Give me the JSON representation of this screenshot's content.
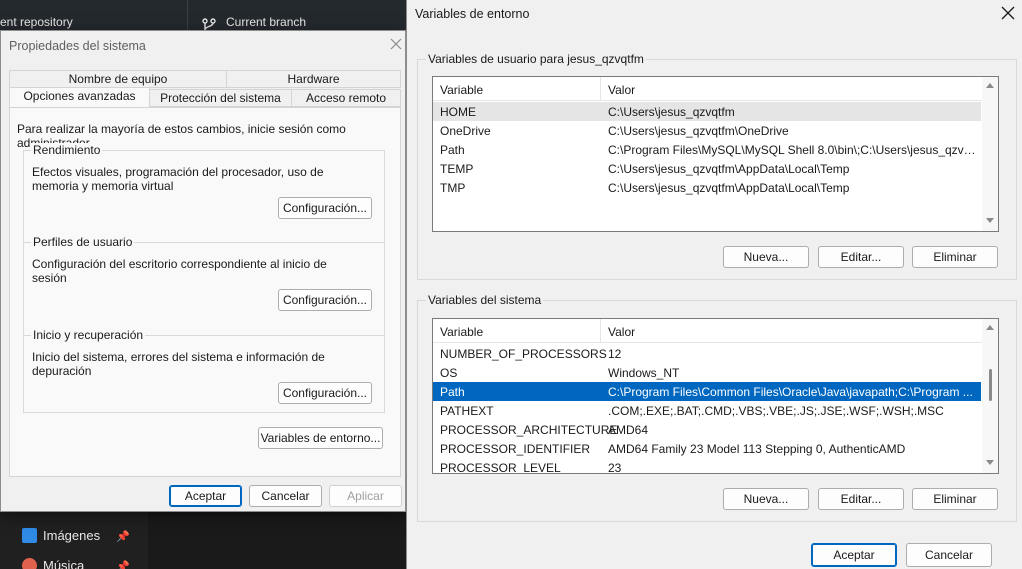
{
  "background_app": {
    "repo_label": "ent repository",
    "branch_label": "Current branch",
    "nav_items": [
      {
        "label": "Imágenes",
        "icon": "images-icon"
      },
      {
        "label": "Música",
        "icon": "music-icon"
      }
    ]
  },
  "system_properties": {
    "title": "Propiedades del sistema",
    "tabs": [
      "Nombre de equipo",
      "Hardware",
      "Opciones avanzadas",
      "Protección del sistema",
      "Acceso remoto"
    ],
    "active_tab": "Opciones avanzadas",
    "intro": "Para realizar la mayoría de estos cambios, inicie sesión como administrador.",
    "groups": [
      {
        "title": "Rendimiento",
        "description": "Efectos visuales, programación del procesador, uso de memoria y memoria virtual",
        "button": "Configuración..."
      },
      {
        "title": "Perfiles de usuario",
        "description": "Configuración del escritorio correspondiente al inicio de sesión",
        "button": "Configuración..."
      },
      {
        "title": "Inicio y recuperación",
        "description": "Inicio del sistema, errores del sistema e información de depuración",
        "button": "Configuración..."
      }
    ],
    "env_button": "Variables de entorno...",
    "ok_button": "Aceptar",
    "cancel_button": "Cancelar",
    "apply_button": "Aplicar"
  },
  "env_vars": {
    "title": "Variables de entorno",
    "user_group_title": "Variables de usuario para jesus_qzvqtfm",
    "system_group_title": "Variables del sistema",
    "col_variable": "Variable",
    "col_value": "Valor",
    "user_vars": [
      {
        "name": "HOME",
        "value": "C:\\Users\\jesus_qzvqtfm"
      },
      {
        "name": "OneDrive",
        "value": "C:\\Users\\jesus_qzvqtfm\\OneDrive"
      },
      {
        "name": "Path",
        "value": "C:\\Program Files\\MySQL\\MySQL Shell 8.0\\bin\\;C:\\Users\\jesus_qzvq..."
      },
      {
        "name": "TEMP",
        "value": "C:\\Users\\jesus_qzvqtfm\\AppData\\Local\\Temp"
      },
      {
        "name": "TMP",
        "value": "C:\\Users\\jesus_qzvqtfm\\AppData\\Local\\Temp"
      }
    ],
    "system_vars": [
      {
        "name": "NUMBER_OF_PROCESSORS",
        "value": "12"
      },
      {
        "name": "OS",
        "value": "Windows_NT"
      },
      {
        "name": "Path",
        "value": "C:\\Program Files\\Common Files\\Oracle\\Java\\javapath;C:\\Program ..."
      },
      {
        "name": "PATHEXT",
        "value": ".COM;.EXE;.BAT;.CMD;.VBS;.VBE;.JS;.JSE;.WSF;.WSH;.MSC"
      },
      {
        "name": "PROCESSOR_ARCHITECTURE",
        "value": "AMD64"
      },
      {
        "name": "PROCESSOR_IDENTIFIER",
        "value": "AMD64 Family 23 Model 113 Stepping 0, AuthenticAMD"
      },
      {
        "name": "PROCESSOR_LEVEL",
        "value": "23"
      }
    ],
    "user_buttons": {
      "new": "Nueva...",
      "edit": "Editar...",
      "delete": "Eliminar"
    },
    "system_buttons": {
      "new": "Nueva...",
      "edit": "Editar...",
      "delete": "Eliminar"
    },
    "ok_button": "Aceptar",
    "cancel_button": "Cancelar"
  },
  "colors": {
    "selection": "#0067c0",
    "hover_row": "#e5e5e5",
    "dialog_bg": "#f0f0f0"
  }
}
